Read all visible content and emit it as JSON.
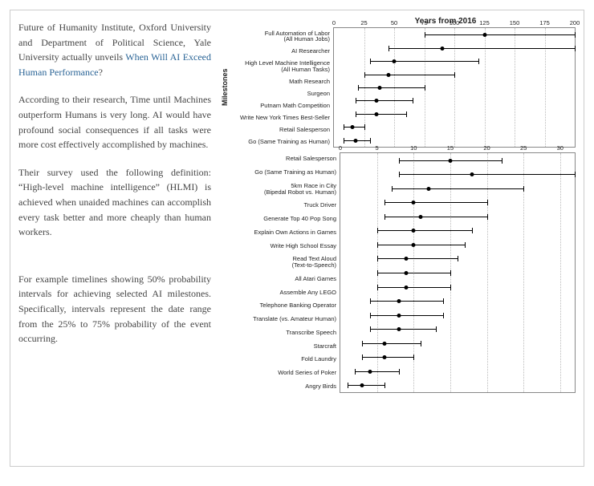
{
  "paragraphs": {
    "p1_pre": "Future of Humanity Institute, Oxford University and Department of Political Science, Yale University actually unveils ",
    "p1_link": "When Will AI Exceed Human Performance",
    "p1_post": "?",
    "p2": "According to their research, Time until Machines outperform Humans is very long. AI would have profound social consequences if all tasks were more cost effectively accomplished by machines.",
    "p3": "Their survey used the following definition: “High-level machine intelligence” (HLMI) is achieved when unaided machines can accomplish every task better and more cheaply than human workers.",
    "p4": "For example timelines showing 50% probability intervals for achieving selected AI milestones. Specifically, intervals represent the date range from the 25% to 75% probability of the event occurring."
  },
  "chart_data": [
    {
      "type": "interval-dot",
      "title": "Years from 2016",
      "ylabel": "Milestones",
      "xlim": [
        0,
        200
      ],
      "xticks": [
        0,
        25,
        50,
        75,
        100,
        125,
        150,
        175,
        200
      ],
      "series": [
        {
          "name": "Full Automation of Labor\n(All Human Jobs)",
          "low": 75,
          "median": 125,
          "high": 200
        },
        {
          "name": "AI Researcher",
          "low": 45,
          "median": 90,
          "high": 200
        },
        {
          "name": "High Level Machine Intelligence\n(All Human Tasks)",
          "low": 30,
          "median": 50,
          "high": 120
        },
        {
          "name": "Math Research",
          "low": 25,
          "median": 45,
          "high": 100
        },
        {
          "name": "Surgeon",
          "low": 20,
          "median": 38,
          "high": 75
        },
        {
          "name": "Putnam Math Competition",
          "low": 18,
          "median": 35,
          "high": 65
        },
        {
          "name": "Write New York Times Best-Seller",
          "low": 18,
          "median": 35,
          "high": 60
        },
        {
          "name": "Retail Salesperson",
          "low": 8,
          "median": 15,
          "high": 25
        },
        {
          "name": "Go (Same Training as Human)",
          "low": 8,
          "median": 18,
          "high": 30
        }
      ]
    },
    {
      "type": "interval-dot",
      "title": "",
      "ylabel": "",
      "xlim": [
        0,
        32
      ],
      "xticks": [
        0,
        5,
        10,
        15,
        20,
        25,
        30
      ],
      "series": [
        {
          "name": "Retail Salesperson",
          "low": 8,
          "median": 15,
          "high": 22
        },
        {
          "name": "Go (Same Training as Human)",
          "low": 8,
          "median": 18,
          "high": 32
        },
        {
          "name": "5km Race in City\n(Bipedal Robot vs. Human)",
          "low": 7,
          "median": 12,
          "high": 25
        },
        {
          "name": "Truck Driver",
          "low": 6,
          "median": 10,
          "high": 20
        },
        {
          "name": "Generate Top 40 Pop Song",
          "low": 6,
          "median": 11,
          "high": 20
        },
        {
          "name": "Explain Own Actions in Games",
          "low": 5,
          "median": 10,
          "high": 18
        },
        {
          "name": "Write High School Essay",
          "low": 5,
          "median": 10,
          "high": 17
        },
        {
          "name": "Read Text Aloud\n(Text-to-Speech)",
          "low": 5,
          "median": 9,
          "high": 16
        },
        {
          "name": "All Atari Games",
          "low": 5,
          "median": 9,
          "high": 15
        },
        {
          "name": "Assemble Any LEGO",
          "low": 5,
          "median": 9,
          "high": 15
        },
        {
          "name": "Telephone Banking Operator",
          "low": 4,
          "median": 8,
          "high": 14
        },
        {
          "name": "Translate (vs. Amateur Human)",
          "low": 4,
          "median": 8,
          "high": 14
        },
        {
          "name": "Transcribe Speech",
          "low": 4,
          "median": 8,
          "high": 13
        },
        {
          "name": "Starcraft",
          "low": 3,
          "median": 6,
          "high": 11
        },
        {
          "name": "Fold Laundry",
          "low": 3,
          "median": 6,
          "high": 10
        },
        {
          "name": "World Series of Poker",
          "low": 2,
          "median": 4,
          "high": 8
        },
        {
          "name": "Angry Birds",
          "low": 1,
          "median": 3,
          "high": 6
        }
      ]
    }
  ]
}
